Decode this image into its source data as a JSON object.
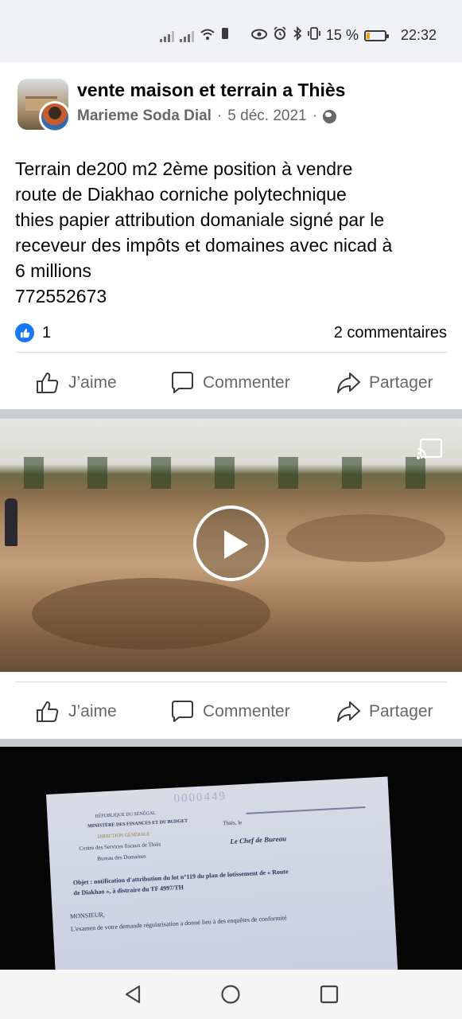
{
  "status_bar": {
    "battery_level": "15 %",
    "battery_fraction": 0.15,
    "time": "22:32",
    "icons": [
      "signal-icon",
      "signal-icon",
      "wifi-icon",
      "sim-icon",
      "eye-icon",
      "alarm-icon",
      "bluetooth-icon",
      "vibrate-icon",
      "battery-icon"
    ]
  },
  "post": {
    "group_name": "vente maison et terrain a Thiès",
    "author": "Marieme Soda Dial",
    "separator": "·",
    "date": "5 déc. 2021",
    "privacy_icon": "globe-icon",
    "text_lines": [
      "Terrain de200 m2 2ème position à vendre",
      "route de Diakhao corniche polytechnique",
      "thies papier attribution domaniale signé par le",
      "receveur des impôts et domaines avec nicad à",
      "6 millions",
      "772552673"
    ],
    "reaction_count": "1",
    "comments": "2 commentaires"
  },
  "actions": {
    "like": "J’aime",
    "comment": "Commenter",
    "share": "Partager"
  },
  "video": {
    "play_icon": "play-icon",
    "cast_icon": "cast-icon"
  },
  "document": {
    "serial": "0000449",
    "header": "RÉPUBLIQUE DU SÉNÉGAL",
    "ministry": "MINISTÈRE DES FINANCES ET DU BUDGET",
    "directorate": "DIRECTION GÉNÉRALE",
    "center": "Centre des Services fiscaux de Thiès",
    "bureau": "Bureau des Domaines",
    "city": "Thiès, le",
    "chef": "Le Chef de Bureau",
    "object_line1": "Objet : notification d'attribution du lot n°119 du plan de lotissement de « Route",
    "object_line2": "de Diakhao », à distraire du TF 4997/TH",
    "salutation": "MONSIEUR,",
    "body_line": "L'examen de votre demande régularisation a donné lieu à des enquêtes de conformité"
  },
  "nav": {
    "back_icon": "back-triangle-icon",
    "home_icon": "home-circle-icon",
    "recents_icon": "recents-square-icon"
  }
}
